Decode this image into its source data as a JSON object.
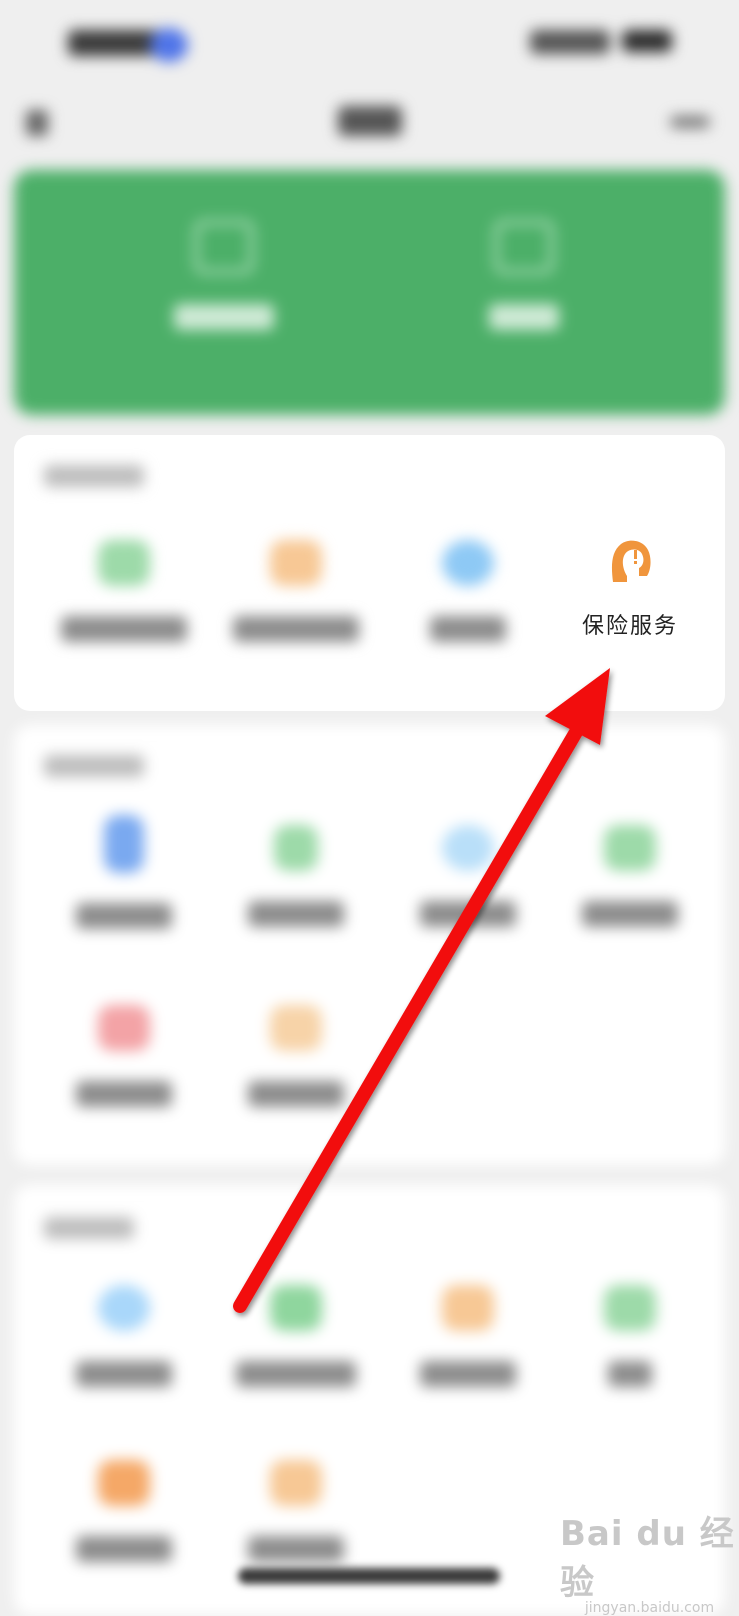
{
  "insurance_tile": {
    "label": "保险服务",
    "icon": "insurance-icon"
  },
  "colors": {
    "hero_green": "#4caf68",
    "insurance_orange": "#f0953c",
    "arrow_red": "#f20f0f"
  },
  "watermark": {
    "brand": "Bai du 经验",
    "url": "jingyan.baidu.com"
  }
}
